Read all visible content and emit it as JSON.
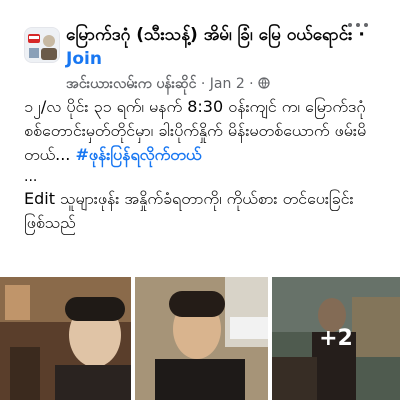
{
  "header": {
    "group_name": "မြောက်ဒဂုံ (သီးသန့်) အိမ်၊ ခြံ၊ မြေ ဝယ်ရောင်း",
    "separator": " · ",
    "join_label": "Join",
    "author": "အင်းယားလမ်းက ပန်းဆိုင်",
    "date": "Jan 2",
    "menu_icon": "more-horizontal-icon",
    "privacy_icon": "globe-icon"
  },
  "post": {
    "text_main": "၁၂/လ ပိုင်း ၃၁ ရက်၊ မနက် 8:30 ဝန်းကျင် က၊ မြောက်ဒဂုံ စစ်တောင်းမှတ်တိုင်မှာ၊ ခါးပိုက်နှိုက် မိန်းမတစ်ယောက် ဖမ်းမိတယ်... ",
    "hashtag": "#ဖုန်းပြန်ရလိုက်တယ်",
    "ellipsis": "...",
    "text_edit": "Edit သူများဖုန်း အနှိုက်ခံရတာကို၊ ကိုယ်စား တင်ပေးခြင်းဖြစ်သည်"
  },
  "photos": {
    "more_count": "+2"
  },
  "colors": {
    "link_blue": "#1877f2",
    "meta_gray": "#65676b",
    "text": "#050505"
  }
}
